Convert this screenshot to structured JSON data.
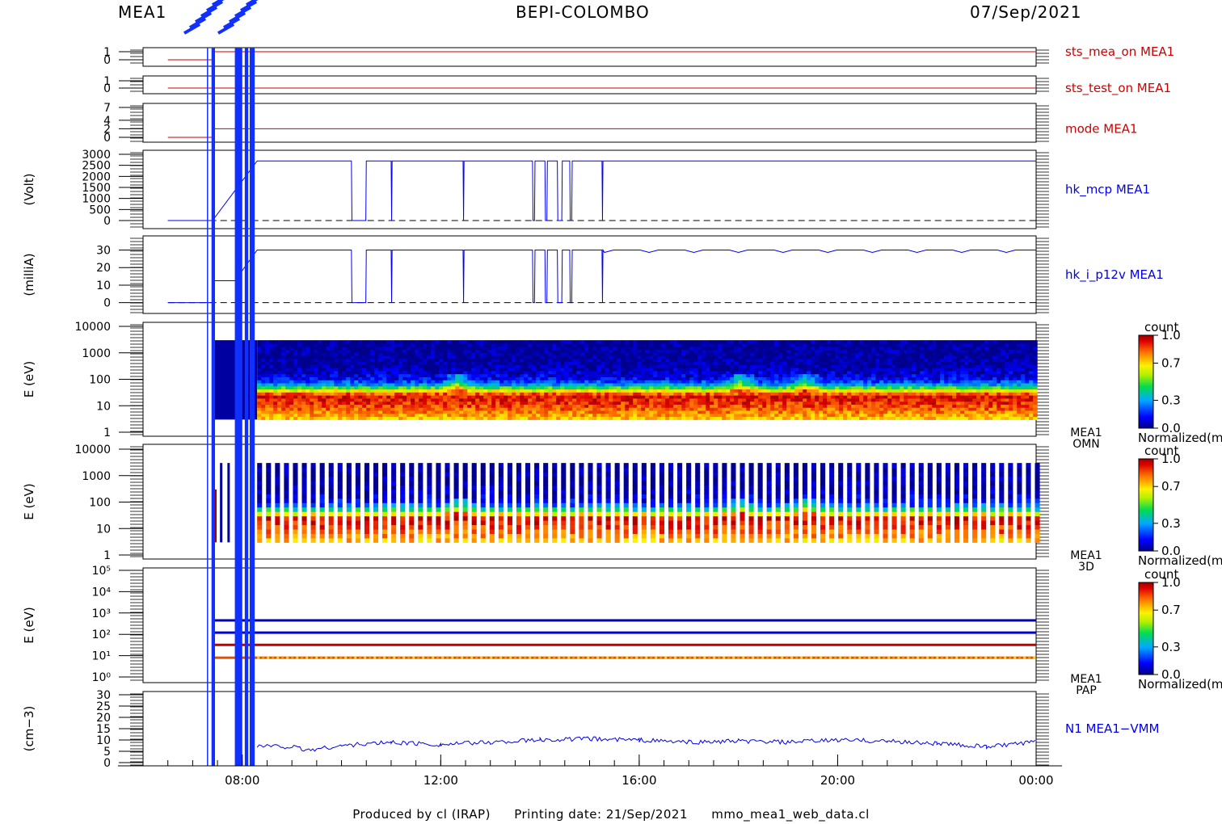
{
  "header": {
    "instrument": "MEA1",
    "mission": "BEPI-COLOMBO",
    "date": "07/Sep/2021"
  },
  "footer": {
    "produced_by": "Produced by cl (IRAP)",
    "printing_date": "Printing date: 21/Sep/2021",
    "script": "mmo_mea1_web_data.cl"
  },
  "colors": {
    "status_red": "#cc0000",
    "data_blue": "#0000ee",
    "axis": "#000000"
  },
  "chart_data": {
    "type": "multi-panel time series",
    "x": {
      "unit": "hour",
      "range": [
        6.0,
        24.0
      ],
      "ticks": [
        8,
        12,
        16,
        20,
        24
      ],
      "tick_labels": [
        "08:00",
        "12:00",
        "16:00",
        "20:00",
        "00:00"
      ]
    },
    "gap_intervals_hours": [
      [
        7.38,
        7.45
      ],
      [
        7.85,
        8.0
      ],
      [
        8.05,
        8.12
      ],
      [
        8.15,
        8.25
      ]
    ],
    "colorbar": {
      "title": "count",
      "ticks": [
        0.0,
        0.3,
        0.7,
        1.0
      ],
      "tick_labels": [
        "0.0",
        "0.3",
        "0.7",
        "1.0"
      ],
      "label": "Normalized(m"
    },
    "panels": [
      {
        "id": "sts_mea_on",
        "type": "step",
        "label": "sts_mea_on MEA1",
        "ylim": [
          0,
          1
        ],
        "ytick_labels": [
          "1",
          "0"
        ],
        "series": [
          {
            "color": "red",
            "points": [
              [
                6.5,
                0
              ],
              [
                7.4,
                0
              ],
              [
                7.4,
                1
              ],
              [
                24.0,
                1
              ]
            ]
          }
        ]
      },
      {
        "id": "sts_test_on",
        "type": "step",
        "label": "sts_test_on MEA1",
        "ylim": [
          0,
          1
        ],
        "ytick_labels": [
          "1",
          "0"
        ],
        "series": [
          {
            "color": "red",
            "points": [
              [
                6.5,
                0
              ],
              [
                24.0,
                0
              ]
            ]
          }
        ]
      },
      {
        "id": "mode",
        "type": "step",
        "label": "mode MEA1",
        "ylim": [
          0,
          7
        ],
        "ytick_labels": [
          "7",
          "4",
          "2",
          "0"
        ],
        "series": [
          {
            "color": "red",
            "points": [
              [
                6.5,
                0
              ],
              [
                7.4,
                0
              ],
              [
                7.4,
                2
              ],
              [
                24.0,
                2
              ]
            ]
          }
        ]
      },
      {
        "id": "hk_mcp",
        "type": "line",
        "ylabel": "(Volt)",
        "label": "hk_mcp MEA1",
        "ylim": [
          0,
          3000
        ],
        "ytick_labels": [
          "3000",
          "2500",
          "2000",
          "1500",
          "1000",
          "500",
          "0"
        ],
        "dashed_zero": true,
        "level_on": 2700,
        "level_off": 0,
        "off_intervals_hours": [
          [
            10.2,
            10.5
          ],
          [
            11.0,
            11.02
          ],
          [
            12.45,
            12.47
          ],
          [
            13.85,
            13.9
          ],
          [
            14.1,
            14.15
          ],
          [
            14.35,
            14.45
          ],
          [
            14.6,
            14.65
          ],
          [
            15.25,
            15.27
          ]
        ]
      },
      {
        "id": "hk_i_p12v",
        "type": "line",
        "ylabel": "(milliA)",
        "label": "hk_i_p12v MEA1",
        "ylim": [
          -2,
          33
        ],
        "ytick_labels": [
          "30",
          "20",
          "10",
          "0"
        ],
        "dashed_zero": true,
        "level_on": 30,
        "level_pre": 12.5,
        "off_intervals_hours": [
          [
            10.2,
            10.5
          ],
          [
            11.0,
            11.02
          ],
          [
            12.45,
            12.47
          ],
          [
            13.85,
            13.9
          ],
          [
            14.1,
            14.15
          ],
          [
            14.35,
            14.45
          ],
          [
            14.6,
            14.65
          ],
          [
            15.25,
            15.27
          ]
        ]
      },
      {
        "id": "omn",
        "type": "spectrogram",
        "ylabel": "E (eV)",
        "label_top": "MEA1",
        "label_bottom": "OMN",
        "yscale": "log",
        "ylim": [
          1,
          10000
        ],
        "ytick_labels": [
          "10000",
          "1000",
          "100",
          "10",
          "1"
        ],
        "energy_range": [
          3,
          3000
        ],
        "profile_log10E_to_count": [
          [
            0.5,
            0.72
          ],
          [
            1.0,
            0.88
          ],
          [
            1.4,
            0.95
          ],
          [
            1.6,
            0.6
          ],
          [
            1.8,
            0.3
          ],
          [
            2.0,
            0.12
          ],
          [
            2.5,
            0.02
          ],
          [
            3.5,
            0.0
          ]
        ],
        "enhanced_hours": [
          12.3,
          18.0,
          19.3
        ]
      },
      {
        "id": "3d",
        "type": "spectrogram",
        "ylabel": "E (eV)",
        "label_top": "MEA1",
        "label_bottom": "3D",
        "yscale": "log",
        "ylim": [
          1,
          10000
        ],
        "ytick_labels": [
          "10000",
          "1000",
          "100",
          "10",
          "1"
        ],
        "energy_range": [
          3,
          3000
        ],
        "bars_start_hour": 8.3,
        "bars_per_hour": 5.55,
        "bar_fraction": 0.55
      },
      {
        "id": "pap",
        "type": "spectrogram",
        "ylabel": "E (eV)",
        "label_top": "MEA1",
        "label_bottom": "PAP",
        "yscale": "log",
        "ylim": [
          1,
          100000
        ],
        "ytick_labels": [
          "10⁵",
          "10⁴",
          "10³",
          "10²",
          "10¹",
          "10⁰"
        ],
        "bands_eV": [
          450,
          120,
          32,
          8
        ]
      },
      {
        "id": "n1",
        "type": "line",
        "ylabel": "(cm−3)",
        "label": "N1 MEA1−VMM",
        "ylim": [
          0,
          30
        ],
        "ytick_labels": [
          "30",
          "25",
          "20",
          "15",
          "10",
          "5",
          "0"
        ],
        "series": [
          {
            "color": "blue",
            "points": [
              [
                8.3,
                7.5
              ],
              [
                9.0,
                7.0
              ],
              [
                9.3,
                5.5
              ],
              [
                10.0,
                7.5
              ],
              [
                11.0,
                9.0
              ],
              [
                12.0,
                8.0
              ],
              [
                13.0,
                9.0
              ],
              [
                14.0,
                10.0
              ],
              [
                15.0,
                10.5
              ],
              [
                16.0,
                10.0
              ],
              [
                17.0,
                9.0
              ],
              [
                18.0,
                9.5
              ],
              [
                19.0,
                9.0
              ],
              [
                20.0,
                10.0
              ],
              [
                21.0,
                9.5
              ],
              [
                22.0,
                8.5
              ],
              [
                23.0,
                7.0
              ],
              [
                23.5,
                8.0
              ],
              [
                24.0,
                9.0
              ]
            ]
          }
        ]
      }
    ]
  }
}
